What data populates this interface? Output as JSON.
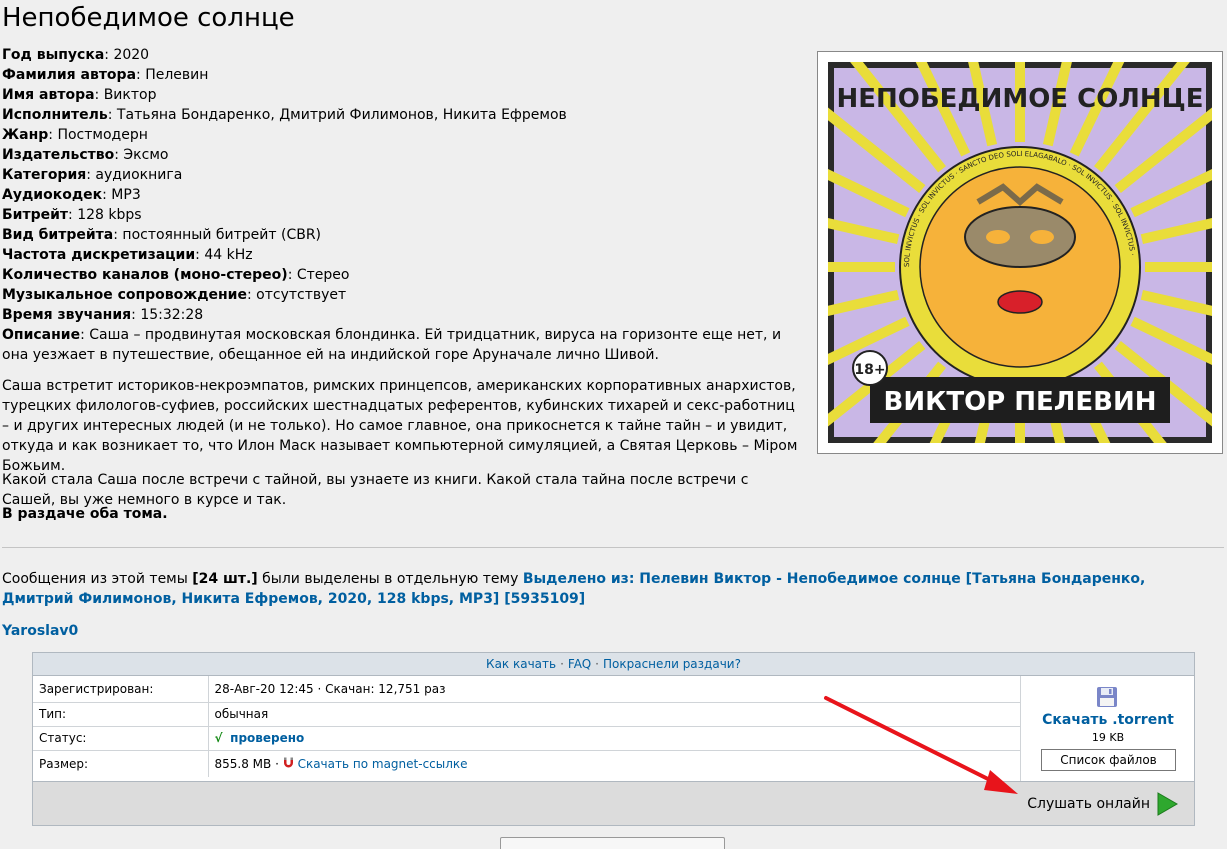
{
  "title": "Непобедимое солнце",
  "meta": [
    {
      "label": "Год выпуска",
      "value": ": 2020"
    },
    {
      "label": "Фамилия автора",
      "value": ": Пелевин"
    },
    {
      "label": "Имя автора",
      "value": ": Виктор"
    },
    {
      "label": "Исполнитель",
      "value": ": Татьяна Бондаренко, Дмитрий Филимонов, Никита Ефремов"
    },
    {
      "label": "Жанр",
      "value": ": Постмодерн"
    },
    {
      "label": "Издательство",
      "value": ": Эксмо"
    },
    {
      "label": "Категория",
      "value": ": аудиокнига"
    },
    {
      "label": "Аудиокодек",
      "value": ": MP3"
    },
    {
      "label": "Битрейт",
      "value": ": 128 kbps"
    },
    {
      "label": "Вид битрейта",
      "value": ": постоянный битрейт (CBR)"
    },
    {
      "label": "Частота дискретизации",
      "value": ": 44 kHz"
    },
    {
      "label": "Количество каналов (моно-стерео)",
      "value": ": Стерео"
    },
    {
      "label": "Музыкальное сопровождение",
      "value": ": отсутствует"
    },
    {
      "label": "Время звучания",
      "value": ": 15:32:28"
    },
    {
      "label": "Описание",
      "value": ": Саша – продвинутая московская блондинка. Ей тридцатник, вируса на горизонте еще нет, и она уезжает в путешествие, обещанное ей на индийской горе Аруначале лично Шивой."
    }
  ],
  "para1": "Саша встретит историков-некроэмпатов, римских принцепсов, американских корпоративных анархистов, турецких филологов-суфиев, российских шестнадцатых референтов, кубинских тихарей и секс-работниц – и других интересных людей (и не только). Но самое главное, она прикоснется к тайне тайн – и увидит, откуда и как возникает то, что Илон Маск называет компьютерной симуляцией, а Святая Церковь – Міром Божьим.",
  "para2": "Какой стала Саша после встречи с тайной, вы узнаете из книги. Какой стала тайна после встречи с Сашей, вы уже немного в курсе и так.",
  "para3": "В раздаче оба тома.",
  "cover": {
    "title": "НЕПОБЕДИМОЕ СОЛНЦЕ",
    "author": "ВИКТОР ПЕЛЕВИН",
    "age": "18+",
    "ring_text": "SOL INVICTUS · SOL INVICTUS · SANCTO DEO SOLI ELAGABALO · SOL INVICTUS · SOL INVICTUS ·"
  },
  "notice": {
    "prefix": "Сообщения из этой темы ",
    "count": "[24 шт.]",
    "middle": " были выделены в отдельную тему ",
    "link": "Выделено из: Пелевин Виктор - Непобедимое солнце [Татьяна Бондаренко, Дмитрий Филимонов, Никита Ефремов, 2020, 128 kbps, MP3] [5935109]"
  },
  "user": "Yaroslav0",
  "torrent": {
    "head_links": [
      "Как качать",
      "FAQ",
      "Покраснели раздачи?"
    ],
    "sep": "·",
    "rows": {
      "registered_label": "Зарегистрирован:",
      "registered_value": "28-Авг-20 12:45",
      "downloaded": "Скачан: 12,751 раз",
      "type_label": "Тип:",
      "type_value": "обычная",
      "status_label": "Статус:",
      "status_check": "√",
      "status_value": "проверено",
      "size_label": "Размер:",
      "size_value": "855.8 MB",
      "magnet_link": "Скачать по magnet-ссылке"
    },
    "download_label": "Скачать .torrent",
    "download_size": "19 KB",
    "files_button": "Список файлов",
    "listen_label": "Слушать онлайн"
  },
  "colors": {
    "link": "#005fa0",
    "arrow": "#e8141b",
    "play": "#2ea82e"
  }
}
